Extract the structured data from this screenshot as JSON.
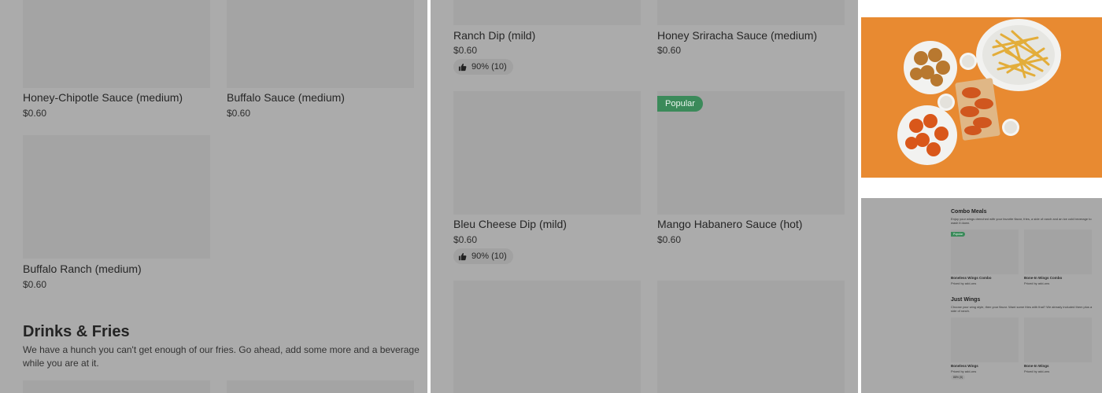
{
  "left_panel": {
    "items": [
      {
        "name": "Honey-Chipotle Sauce (medium)",
        "price": "$0.60"
      },
      {
        "name": "Buffalo Sauce (medium)",
        "price": "$0.60"
      },
      {
        "name": "Buffalo Ranch (medium)",
        "price": "$0.60"
      }
    ],
    "section": {
      "title": "Drinks & Fries",
      "description": "We have a hunch you can't get enough of our fries. Go ahead, add some more and a beverage while you are at it."
    }
  },
  "middle_panel": {
    "items": [
      {
        "name": "Ranch Dip (mild)",
        "price": "$0.60",
        "rating": "90% (10)"
      },
      {
        "name": "Honey Sriracha Sauce (medium)",
        "price": "$0.60"
      },
      {
        "name": "Bleu Cheese Dip (mild)",
        "price": "$0.60",
        "rating": "90% (10)"
      },
      {
        "name": "Mango Habanero Sauce (hot)",
        "price": "$0.60",
        "badge": "Popular"
      }
    ]
  },
  "mini_page": {
    "sections": [
      {
        "title": "Combo Meals",
        "description": "Enjoy your wings drenched with your favorite flavor, fries, a side of ranch and an ice cold beverage to wash it down.",
        "badge": "Popular",
        "items": [
          {
            "name": "Boneless Wings Combo",
            "sub": "Priced by add-ons"
          },
          {
            "name": "Bone-In Wings Combo",
            "sub": "Priced by add-ons"
          }
        ]
      },
      {
        "title": "Just Wings",
        "description": "Choose your wing style, then your flavor. Want some fries with that? We already included them plus a side of ranch.",
        "items": [
          {
            "name": "Boneless Wings",
            "sub": "Priced by add-ons",
            "rating": "88% (5)"
          },
          {
            "name": "Bone-In Wings",
            "sub": "Priced by add-ons"
          }
        ]
      }
    ]
  },
  "icons": {
    "rating": "thumbs-up-icon"
  },
  "colors": {
    "overlay": "#ababab",
    "badge": "#3b8a5a",
    "food_background": "#e88a31"
  }
}
